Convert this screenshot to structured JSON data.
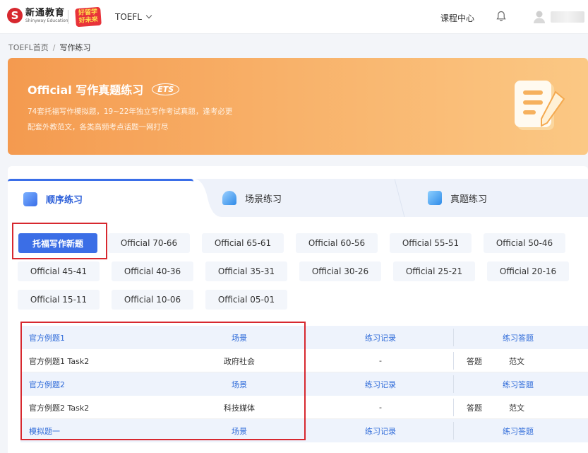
{
  "header": {
    "logo_cn": "新通教育",
    "logo_en": "Shinyway Education",
    "logo_sub": "好留学 好未来",
    "exam": "TOEFL",
    "course_center": "课程中心"
  },
  "breadcrumb": {
    "home": "TOEFL首页",
    "separator": "/",
    "current": "写作练习"
  },
  "banner": {
    "title": "Official 写作真题练习",
    "badge": "ETS",
    "line1": "74套托福写作模拟题，19~22年独立写作考试真题，逢考必更",
    "line2": "配套外教范文，各类高频考点话题一网打尽"
  },
  "tabs": [
    {
      "label": "顺序练习",
      "active": true
    },
    {
      "label": "场景练习",
      "active": false
    },
    {
      "label": "真题练习",
      "active": false
    }
  ],
  "filters": [
    "托福写作新题",
    "Official 70-66",
    "Official 65-61",
    "Official 60-56",
    "Official 55-51",
    "Official 50-46",
    "Official 45-41",
    "Official 40-36",
    "Official 35-31",
    "Official 30-26",
    "Official 25-21",
    "Official 20-16",
    "Official 15-11",
    "Official 10-06",
    "Official 05-01"
  ],
  "table": {
    "groups": [
      {
        "head": {
          "name": "官方例题1",
          "scene": "场景",
          "record": "练习记录",
          "answer": "练习答题"
        },
        "row": {
          "name": "官方例题1 Task2",
          "scene": "政府社会",
          "record": "-",
          "answer_btn": "答题",
          "sample_btn": "范文"
        }
      },
      {
        "head": {
          "name": "官方例题2",
          "scene": "场景",
          "record": "练习记录",
          "answer": "练习答题"
        },
        "row": {
          "name": "官方例题2 Task2",
          "scene": "科技媒体",
          "record": "-",
          "answer_btn": "答题",
          "sample_btn": "范文"
        }
      },
      {
        "head": {
          "name": "模拟题一",
          "scene": "场景",
          "record": "练习记录",
          "answer": "练习答题"
        }
      }
    ]
  },
  "colors": {
    "accent": "#3b6ee6",
    "highlight_box": "#d7282f",
    "banner_start": "#f49a4f",
    "banner_end": "#fbc884"
  }
}
